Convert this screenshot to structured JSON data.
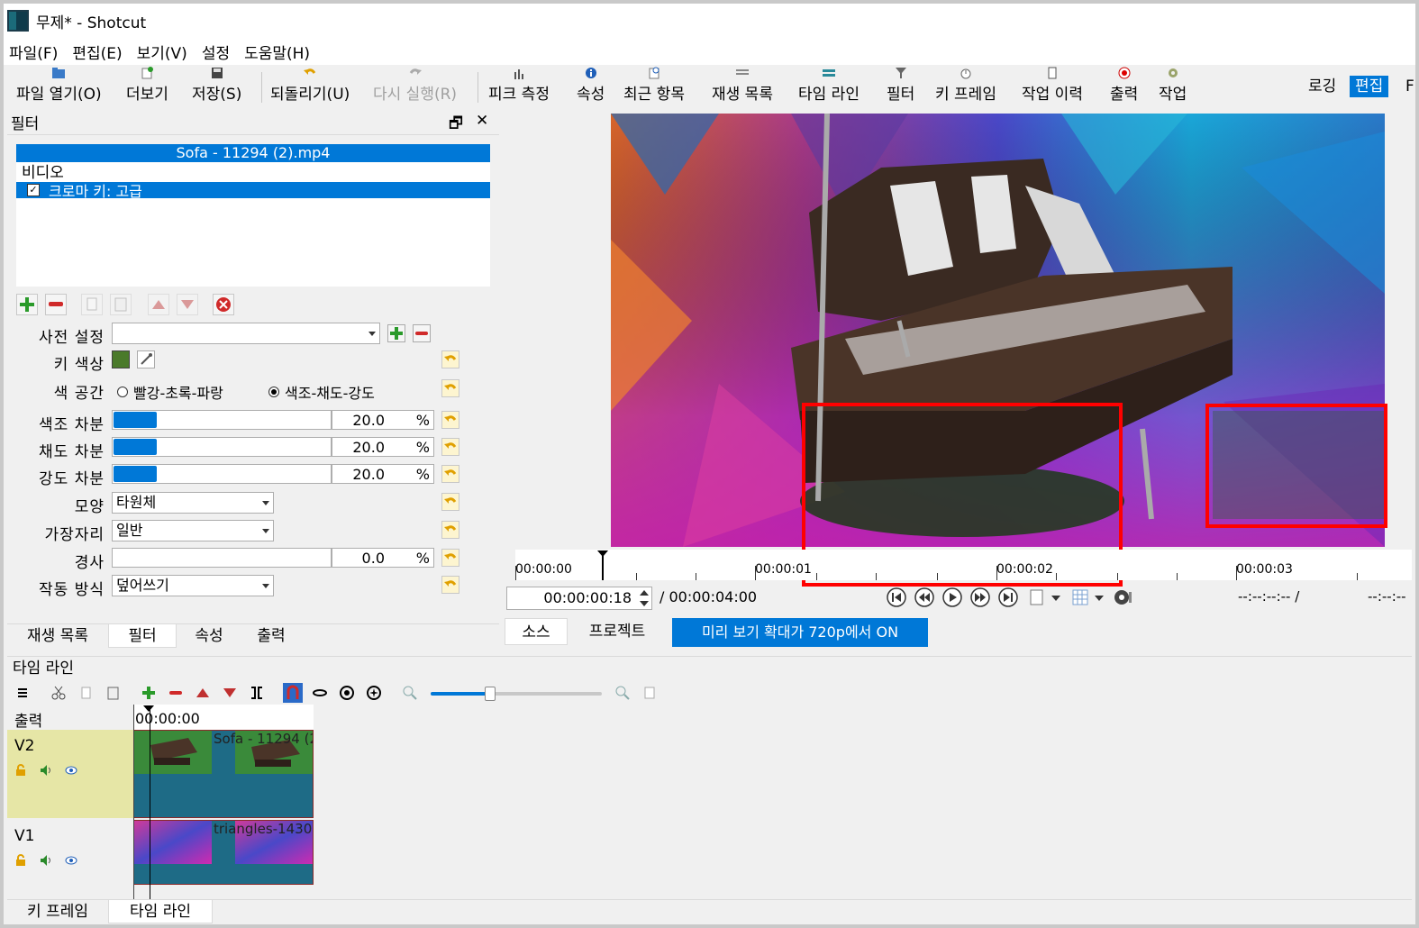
{
  "window": {
    "title": "무제* - Shotcut"
  },
  "menu": [
    "파일(F)",
    "편집(E)",
    "보기(V)",
    "설정",
    "도움말(H)"
  ],
  "toolbar": {
    "open": "파일 열기(O)",
    "more": "더보기",
    "save": "저장(S)",
    "undo": "되돌리기(U)",
    "redo": "다시 실행(R)",
    "peak": "피크 측정",
    "properties": "속성",
    "recent": "최근 항목",
    "playlist": "재생 목록",
    "timeline": "타임 라인",
    "filters": "필터",
    "keyframes": "키 프레임",
    "history": "작업 이력",
    "export": "출력",
    "jobs": "작업",
    "layout_logging": "로깅",
    "layout_editing": "편집",
    "layout_cut": "F"
  },
  "filter_panel": {
    "title": "필터",
    "clip_name": "Sofa - 11294 (2).mp4",
    "category": "비디오",
    "filter_item": "크로마 키: 고급",
    "props": {
      "preset_label": "사전 설정",
      "preset_value": "",
      "key_color_label": "키 색상",
      "key_color": "#4a7a2a",
      "color_space_label": "색 공간",
      "color_space_rgb": "빨강-초록-파랑",
      "color_space_hsv": "색조-채도-강도",
      "hue_label": "색조 차분",
      "hue_value": "20.0",
      "hue_fraction": 0.2,
      "sat_label": "채도 차분",
      "sat_value": "20.0",
      "sat_fraction": 0.2,
      "val_label": "강도 차분",
      "val_value": "20.0",
      "val_fraction": 0.2,
      "shape_label": "모양",
      "shape_value": "타원체",
      "edge_label": "가장자리",
      "edge_value": "일반",
      "slope_label": "경사",
      "slope_value": "0.0",
      "op_label": "작동 방식",
      "op_value": "덮어쓰기",
      "unit": "%"
    },
    "tabs": [
      "재생 목록",
      "필터",
      "속성",
      "출력"
    ]
  },
  "player": {
    "ruler_labels": [
      "00:00:00",
      "00:00:01",
      "00:00:02",
      "00:00:03"
    ],
    "timecode": "00:00:00:18",
    "duration": "/ 00:00:04:00",
    "in_point": "--:--:--:-- /",
    "out_point": "--:--:--",
    "tabs": [
      "소스",
      "프로젝트"
    ],
    "preview_scale": "미리 보기 확대가 720p에서 ON"
  },
  "timeline": {
    "title": "타임 라인",
    "ruler_label": "00:00:00",
    "output_label": "출력",
    "tracks": [
      {
        "name": "V2",
        "clip": "Sofa - 11294 (2"
      },
      {
        "name": "V1",
        "clip": "triangles-1430"
      }
    ]
  },
  "bottom_tabs": [
    "키 프레임",
    "타임 라인"
  ],
  "colors": {
    "accent": "#0078d7",
    "highlight_box": "#ff0000",
    "clip": "#1e6b86",
    "track_selected": "#e6e6a6"
  }
}
